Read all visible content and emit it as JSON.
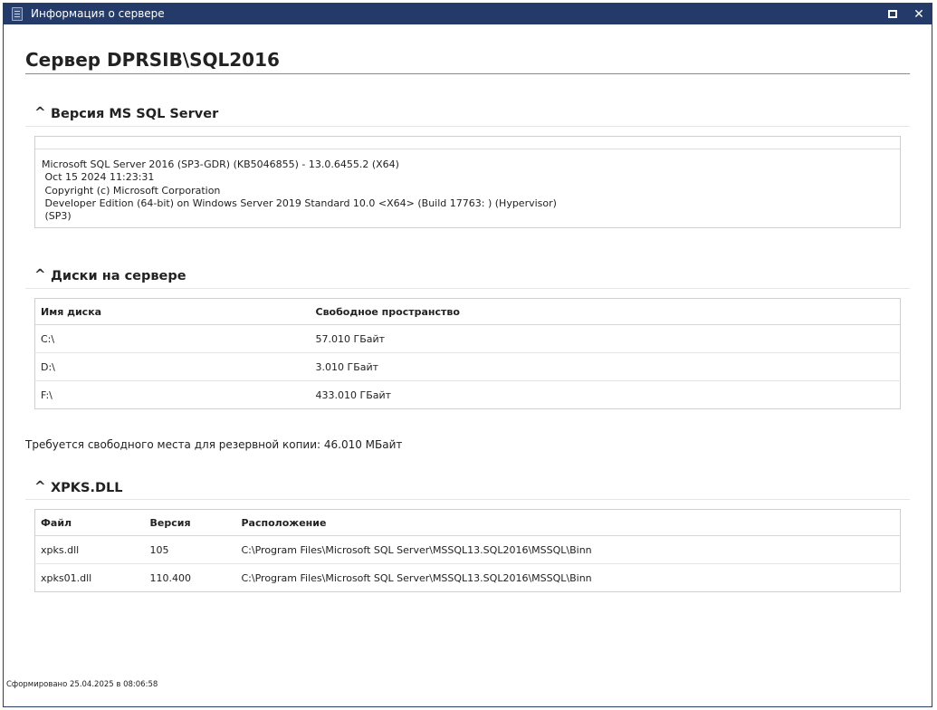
{
  "window": {
    "title": "Информация о сервере",
    "maximize_icon": "maximize-icon",
    "close_glyph": "✕"
  },
  "page": {
    "title": "Сервер DPRSIB\\SQL2016"
  },
  "version_section": {
    "title": "Версия MS SQL Server",
    "text": "Microsoft SQL Server 2016 (SP3-GDR) (KB5046855) - 13.0.6455.2 (X64)\n Oct 15 2024 11:23:31\n Copyright (c) Microsoft Corporation\n Developer Edition (64-bit) on Windows Server 2019 Standard 10.0 <X64> (Build 17763: ) (Hypervisor)\n (SP3)"
  },
  "disks_section": {
    "title": "Диски на сервере",
    "columns": [
      "Имя диска",
      "Свободное пространство"
    ],
    "rows": [
      [
        "C:\\",
        "57.010 ГБайт"
      ],
      [
        "D:\\",
        "3.010 ГБайт"
      ],
      [
        "F:\\",
        "433.010 ГБайт"
      ]
    ]
  },
  "backup_note": "Требуется свободного места для резервной копии: 46.010 МБайт",
  "xpks_section": {
    "title": "XPKS.DLL",
    "columns": [
      "Файл",
      "Версия",
      "Расположение"
    ],
    "rows": [
      [
        "xpks.dll",
        "105",
        "C:\\Program Files\\Microsoft SQL Server\\MSSQL13.SQL2016\\MSSQL\\Binn"
      ],
      [
        "xpks01.dll",
        "110.400",
        "C:\\Program Files\\Microsoft SQL Server\\MSSQL13.SQL2016\\MSSQL\\Binn"
      ]
    ]
  },
  "footer": "Сформировано 25.04.2025 в 08:06:58",
  "colors": {
    "titlebar": "#243a69",
    "border": "#cfcfcf"
  }
}
